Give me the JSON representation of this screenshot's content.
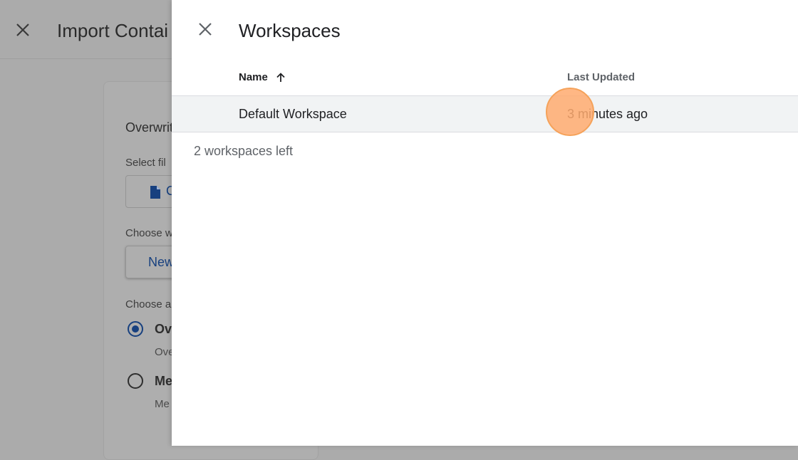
{
  "background": {
    "title": "Import Contai",
    "section_title": "Overwrit",
    "select_file_label": "Select fil",
    "file_button_label": "C",
    "choose_workspace_label": "Choose w",
    "new_button_label": "New",
    "choose_option_label": "Choose a",
    "option_overwrite_label": "Ov",
    "option_overwrite_desc": "Ove",
    "option_merge_label": "Me",
    "option_merge_desc": "Me"
  },
  "panel": {
    "title": "Workspaces",
    "columns": {
      "name": "Name",
      "last_updated": "Last Updated"
    },
    "sort": {
      "column": "name",
      "direction": "ascending"
    },
    "rows": [
      {
        "name": "Default Workspace",
        "last_updated": "3 minutes ago"
      }
    ],
    "footer_note": "2 workspaces left"
  },
  "colors": {
    "accent": "#1a73e8",
    "row_highlight": "#f1f3f4",
    "click_marker": "#ffaa6e"
  }
}
